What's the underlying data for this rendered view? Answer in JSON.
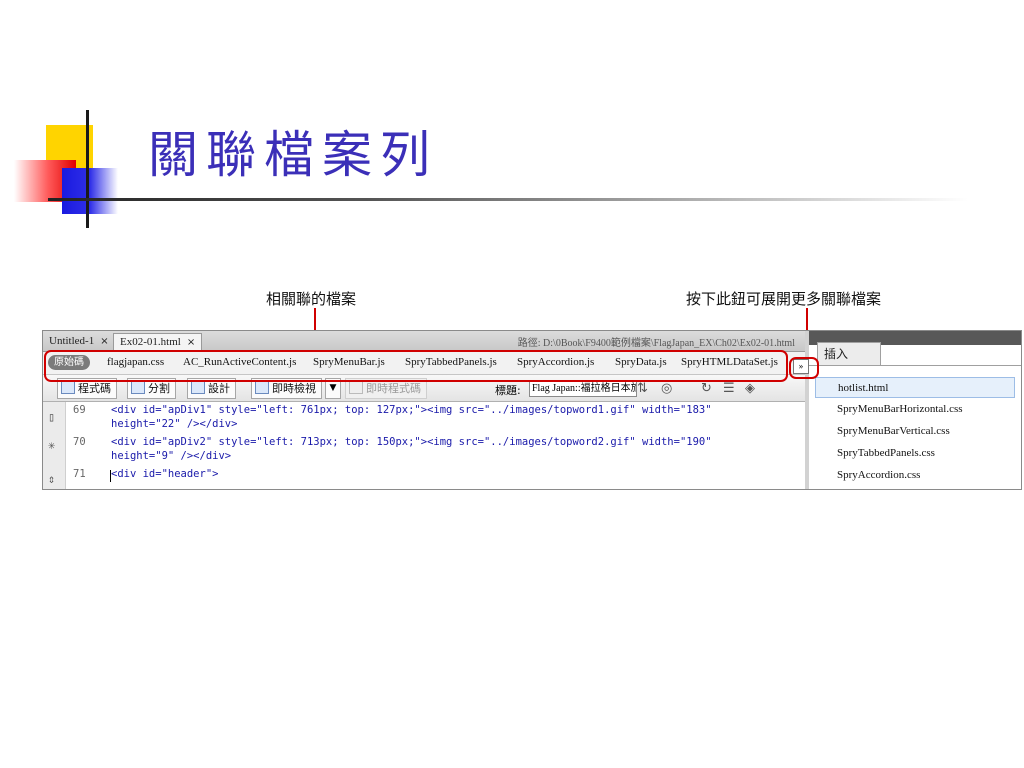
{
  "slide": {
    "title": "關聯檔案列"
  },
  "callouts": {
    "related_files": "相關聯的檔案",
    "expand_button": "按下此鈕可展開更多關聯檔案"
  },
  "document_tabs": {
    "tab1": "Untitled-1",
    "tab2": "Ex02-01.html",
    "close": "×",
    "path": "路徑: D:\\0Book\\F9400範例檔案\\FlagJapan_EX\\Ch02\\Ex02-01.html"
  },
  "related_bar": {
    "source_button": "原始碼",
    "files": [
      "flagjapan.css",
      "AC_RunActiveContent.js",
      "SpryMenuBar.js",
      "SpryTabbedPanels.js",
      "SpryAccordion.js",
      "SpryData.js",
      "SpryHTMLDataSet.js"
    ],
    "expand_glyph": "»"
  },
  "toolbar": {
    "code": "程式碼",
    "split": "分割",
    "design": "設計",
    "live_view": "即時檢視",
    "live_code": "即時程式碼",
    "title_label": "標題:",
    "title_value": "Flag Japan::福拉格日本旅遊資"
  },
  "code_lines": [
    {
      "num": "69",
      "line1": "<div id=\"apDiv1\" style=\"left: 761px; top: 127px;\"><img src=\"../images/topword1.gif\" width=\"183\"",
      "line2": "height=\"22\" /></div>"
    },
    {
      "num": "70",
      "line1": "<div id=\"apDiv2\" style=\"left: 713px; top: 150px;\"><img src=\"../images/topword2.gif\" width=\"190\"",
      "line2": "height=\"9\" /></div>"
    },
    {
      "num": "71",
      "line1": "<div id=\"header\">"
    }
  ],
  "insert_panel": {
    "tab": "插入",
    "items": [
      "hotlist.html",
      "SpryMenuBarHorizontal.css",
      "SpryMenuBarVertical.css",
      "SpryTabbedPanels.css",
      "SpryAccordion.css"
    ]
  },
  "colors": {
    "title": "#3b2fb8",
    "highlight": "#d00000"
  }
}
